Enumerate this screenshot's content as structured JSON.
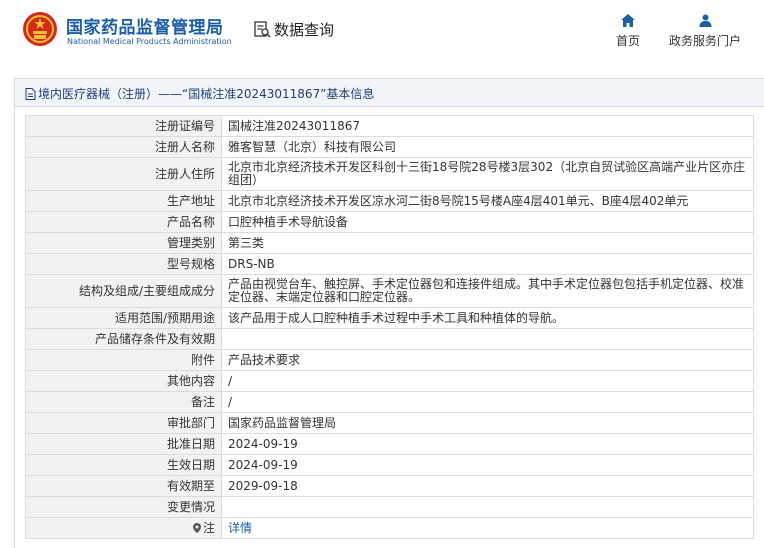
{
  "header": {
    "brand_cn": "国家药品监督管理局",
    "brand_en": "National Medical Products Administration",
    "query_label": "数据查询",
    "nav": {
      "home": "首页",
      "gov_portal": "政务服务门户"
    }
  },
  "panel": {
    "title": "境内医疗器械（注册）——“国械注准20243011867”基本信息"
  },
  "fields": [
    {
      "label": "注册证编号",
      "value": "国械注准20243011867"
    },
    {
      "label": "注册人名称",
      "value": "雅客智慧（北京）科技有限公司"
    },
    {
      "label": "注册人住所",
      "value": "北京市北京经济技术开发区科创十三街18号院28号楼3层302（北京自贸试验区高端产业片区亦庄组团）"
    },
    {
      "label": "生产地址",
      "value": "北京市北京经济技术开发区凉水河二街8号院15号楼A座4层401单元、B座4层402单元"
    },
    {
      "label": "产品名称",
      "value": "口腔种植手术导航设备"
    },
    {
      "label": "管理类别",
      "value": "第三类"
    },
    {
      "label": "型号规格",
      "value": "DRS-NB"
    },
    {
      "label": "结构及组成/主要组成成分",
      "value": "产品由视觉台车、触控屏、手术定位器包和连接件组成。其中手术定位器包包括手机定位器、校准定位器、末端定位器和口腔定位器。"
    },
    {
      "label": "适用范围/预期用途",
      "value": "该产品用于成人口腔种植手术过程中手术工具和种植体的导航。"
    },
    {
      "label": "产品储存条件及有效期",
      "value": ""
    },
    {
      "label": "附件",
      "value": "产品技术要求"
    },
    {
      "label": "其他内容",
      "value": "/"
    },
    {
      "label": "备注",
      "value": "/"
    },
    {
      "label": "审批部门",
      "value": "国家药品监督管理局"
    },
    {
      "label": "批准日期",
      "value": "2024-09-19"
    },
    {
      "label": "生效日期",
      "value": "2024-09-19"
    },
    {
      "label": "有效期至",
      "value": "2029-09-18"
    },
    {
      "label": "变更情况",
      "value": ""
    }
  ],
  "note": {
    "label": "注",
    "link": "详情"
  },
  "colors": {
    "brand_blue": "#1b5fa8",
    "title_blue": "#1d3f7a",
    "emblem_red": "#d7261e",
    "emblem_gold": "#f2c12e"
  },
  "icons": [
    "national-emblem-icon",
    "data-query-icon",
    "home-icon",
    "user-icon",
    "document-icon",
    "location-pin-icon"
  ]
}
